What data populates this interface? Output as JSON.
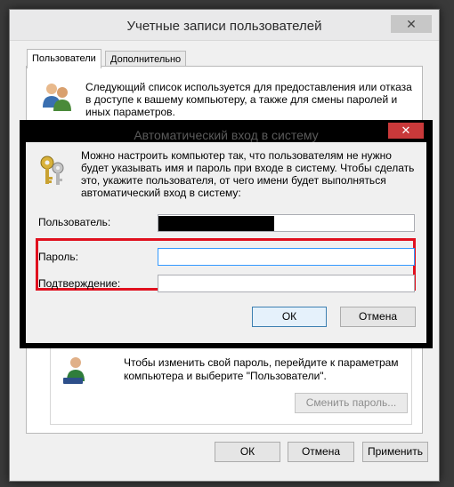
{
  "outer_window": {
    "title": "Учетные записи пользователей",
    "close_glyph": "✕",
    "tabs": [
      "Пользователи",
      "Дополнительно"
    ],
    "users_description": "Следующий список используется для предоставления или отказа в доступе к вашему компьютеру, а также для смены паролей и иных параметров.",
    "password_group_text": "Чтобы изменить свой пароль, перейдите к параметрам компьютера и выберите \"Пользователи\".",
    "change_password_button": "Сменить пароль...",
    "buttons": {
      "ok": "ОК",
      "cancel": "Отмена",
      "apply": "Применить"
    }
  },
  "dialog": {
    "title": "Автоматический вход в систему",
    "close_glyph": "✕",
    "description": "Можно настроить компьютер так, что пользователям не нужно будет указывать имя и пароль при входе в систему. Чтобы сделать это, укажите пользователя, от чего имени будет выполняться автоматический вход в систему:",
    "user_label": "Пользователь:",
    "password_label": "Пароль:",
    "confirm_label": "Подтверждение:",
    "user_value": "",
    "password_value": "",
    "confirm_value": "",
    "ok_button": "ОК",
    "cancel_button": "Отмена"
  },
  "colors": {
    "highlight_red": "#e0101e",
    "close_red": "#c9393a",
    "focus_blue": "#3399ff"
  }
}
